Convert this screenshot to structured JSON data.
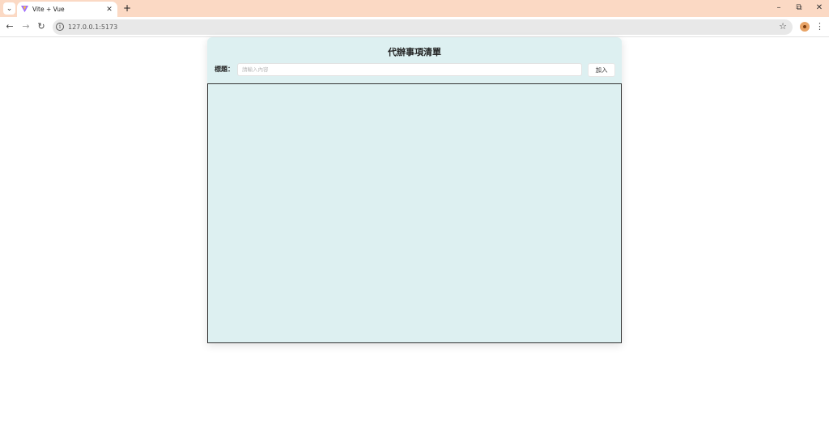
{
  "browser": {
    "tab": {
      "title": "Vite + Vue"
    },
    "new_tab_label": "+",
    "address": {
      "url": "127.0.0.1:5173"
    },
    "window_controls": {
      "minimize": "–",
      "restore": "⧉",
      "close": "✕"
    }
  },
  "app": {
    "title": "代辦事項清單",
    "form": {
      "label": "標題：",
      "input_value": "",
      "input_placeholder": "請輸入內容",
      "add_button": "加入"
    },
    "todos": []
  },
  "colors": {
    "tabbar": "#fbd9c4",
    "app_background": "#ddf0f1",
    "list_border": "#333333"
  }
}
